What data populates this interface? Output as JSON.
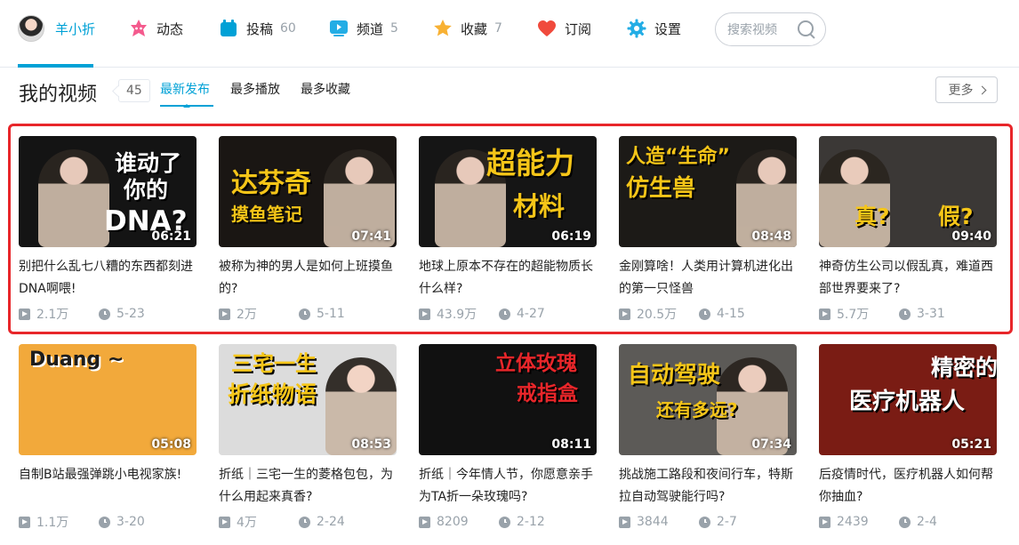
{
  "nav": {
    "user_name": "羊小折",
    "items": [
      {
        "label": "动态",
        "count": "",
        "icon": "dynamic-icon",
        "color": "#f45a8d"
      },
      {
        "label": "投稿",
        "count": "60",
        "icon": "upload-icon",
        "color": "#00a1d6"
      },
      {
        "label": "频道",
        "count": "5",
        "icon": "channel-icon",
        "color": "#23ade5"
      },
      {
        "label": "收藏",
        "count": "7",
        "icon": "favorite-star-icon",
        "color": "#f8b133"
      },
      {
        "label": "订阅",
        "count": "",
        "icon": "heart-icon",
        "color": "#f04a3c"
      },
      {
        "label": "设置",
        "count": "",
        "icon": "gear-icon",
        "color": "#23ade5"
      }
    ],
    "search_placeholder": "搜索视频"
  },
  "section": {
    "title": "我的视频",
    "count": "45",
    "tabs": [
      "最新发布",
      "最多播放",
      "最多收藏"
    ],
    "more": "更多"
  },
  "videos": [
    {
      "title": "别把什么乱七八糟的东西都刻进DNA啊喂!",
      "duration": "06:21",
      "plays": "2.1万",
      "date": "5-23",
      "cover_text": [
        "谁动了",
        "你的",
        "DNA?"
      ],
      "bg": "#141414",
      "accent": "#ffffff"
    },
    {
      "title": "被称为神的男人是如何上班摸鱼的?",
      "duration": "07:41",
      "plays": "2万",
      "date": "5-11",
      "cover_text": [
        "达芬奇",
        "摸鱼笔记"
      ],
      "bg": "#1a1613",
      "accent": "#f5c518"
    },
    {
      "title": "地球上原本不存在的超能物质长什么样?",
      "duration": "06:19",
      "plays": "43.9万",
      "date": "4-27",
      "cover_text": [
        "超能力",
        "材料"
      ],
      "bg": "#151515",
      "accent": "#f5c518"
    },
    {
      "title": "金刚算啥！人类用计算机进化出的第一只怪兽",
      "duration": "08:48",
      "plays": "20.5万",
      "date": "4-15",
      "cover_text": [
        "人造“生命”",
        "仿生兽"
      ],
      "bg": "#1c1a17",
      "accent": "#f5c518"
    },
    {
      "title": "神奇仿生公司以假乱真，难道西部世界要来了?",
      "duration": "09:40",
      "plays": "5.7万",
      "date": "3-31",
      "cover_text": [
        "真?",
        "假?"
      ],
      "bg": "#3b3836",
      "accent": "#f5c518"
    },
    {
      "title": "自制B站最强弹跳小电视家族!",
      "duration": "05:08",
      "plays": "1.1万",
      "date": "3-20",
      "cover_text": [
        "Duang ~"
      ],
      "bg": "#f2a93b",
      "accent": "#1d1d1d"
    },
    {
      "title": "折纸｜三宅一生的菱格包包，为什么用起来真香?",
      "duration": "08:53",
      "plays": "4万",
      "date": "2-24",
      "cover_text": [
        "三宅一生",
        "折纸物语"
      ],
      "bg": "#dcdcdc",
      "accent": "#f5c518"
    },
    {
      "title": "折纸｜今年情人节，你愿意亲手为TA折一朵玫瑰吗?",
      "duration": "08:11",
      "plays": "8209",
      "date": "2-12",
      "cover_text": [
        "立体玫瑰",
        "戒指盒"
      ],
      "bg": "#111111",
      "accent": "#e8262a"
    },
    {
      "title": "挑战施工路段和夜间行车，特斯拉自动驾驶能行吗?",
      "duration": "07:34",
      "plays": "3844",
      "date": "2-7",
      "cover_text": [
        "自动驾驶",
        "还有多远?"
      ],
      "bg": "#5c5a57",
      "accent": "#f5c518"
    },
    {
      "title": "后疫情时代，医疗机器人如何帮你抽血?",
      "duration": "05:21",
      "plays": "2439",
      "date": "2-4",
      "cover_text": [
        "精密的",
        "医疗机器人"
      ],
      "bg": "#7a1c14",
      "accent": "#ffffff"
    }
  ],
  "colors": {
    "accent": "#00a1d6",
    "highlight": "#e8262a",
    "muted": "#99a2aa"
  }
}
